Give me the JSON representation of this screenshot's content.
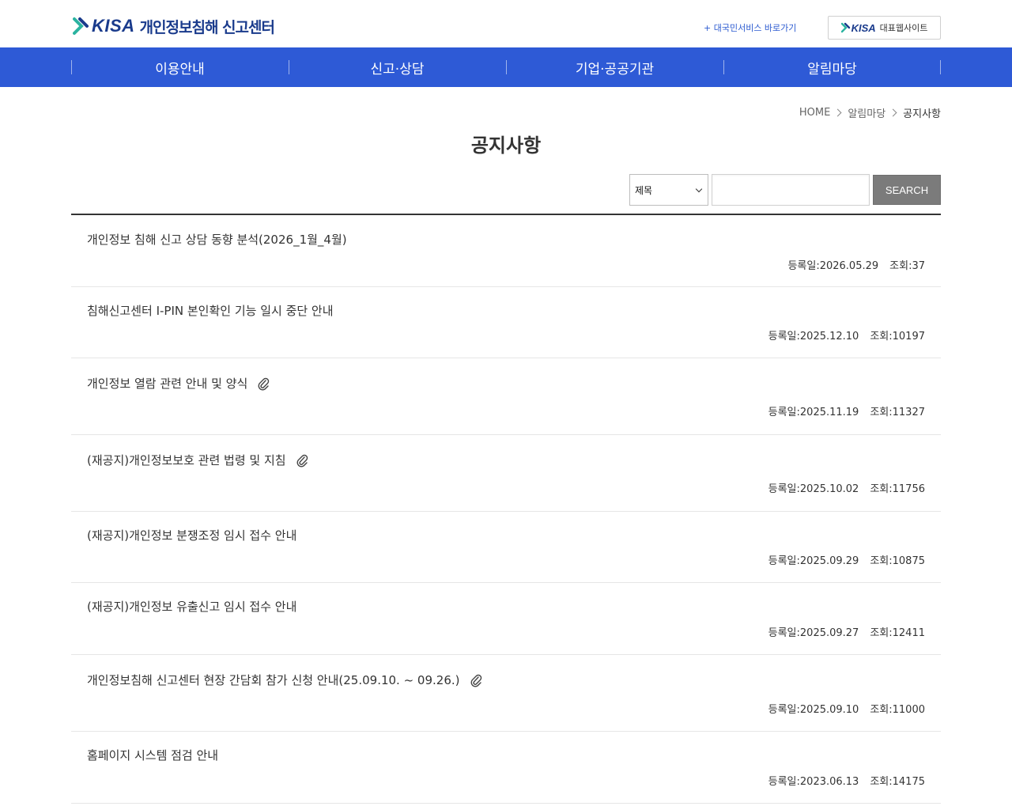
{
  "header": {
    "logo_word": "KISA",
    "logo_title": "개인정보침해 신고센터",
    "gov_link": "+ 대국민서비스 바로가기",
    "site_logo_word": "KISA",
    "site_label": "대표웹사이트"
  },
  "nav": {
    "items": [
      "이용안내",
      "신고·상담",
      "기업·공공기관",
      "알림마당"
    ]
  },
  "breadcrumb": {
    "home": "HOME",
    "section": "알림마당",
    "current": "공지사항"
  },
  "page_title": "공지사항",
  "search": {
    "field_selected": "제목",
    "query": "",
    "button_label": "SEARCH"
  },
  "notices": [
    {
      "title": "개인정보 침해 신고 상담 동향 분석(2026_1월_4월)",
      "date_label": "등록일:2026.05.29",
      "views_label": "조회:37",
      "attachment": false
    },
    {
      "title": "침해신고센터 I-PIN 본인확인 기능 일시 중단 안내",
      "date_label": "등록일:2025.12.10",
      "views_label": "조회:10197",
      "attachment": false
    },
    {
      "title": "개인정보 열람 관련 안내 및 양식",
      "date_label": "등록일:2025.11.19",
      "views_label": "조회:11327",
      "attachment": true
    },
    {
      "title": "(재공지)개인정보보호 관련 법령 및 지침",
      "date_label": "등록일:2025.10.02",
      "views_label": "조회:11756",
      "attachment": true
    },
    {
      "title": "(재공지)개인정보 분쟁조정 임시 접수 안내",
      "date_label": "등록일:2025.09.29",
      "views_label": "조회:10875",
      "attachment": false
    },
    {
      "title": "(재공지)개인정보 유출신고 임시 접수 안내",
      "date_label": "등록일:2025.09.27",
      "views_label": "조회:12411",
      "attachment": false
    },
    {
      "title": "개인정보침해 신고센터 현장 간담회 참가 신청 안내(25.09.10. ~ 09.26.)",
      "date_label": "등록일:2025.09.10",
      "views_label": "조회:11000",
      "attachment": true
    },
    {
      "title": "홈페이지 시스템 점검 안내",
      "date_label": "등록일:2023.06.13",
      "views_label": "조회:14175",
      "attachment": false
    }
  ],
  "icons": {
    "logo": "kisa-logo-icon",
    "attachment": "paperclip-icon",
    "dropdown": "chevron-down-icon",
    "breadcrumb_sep": "chevron-right-icon"
  },
  "colors": {
    "nav_bg": "#2e5ad6",
    "brand": "#1a3b8c",
    "button_bg": "#7b7b7b"
  }
}
